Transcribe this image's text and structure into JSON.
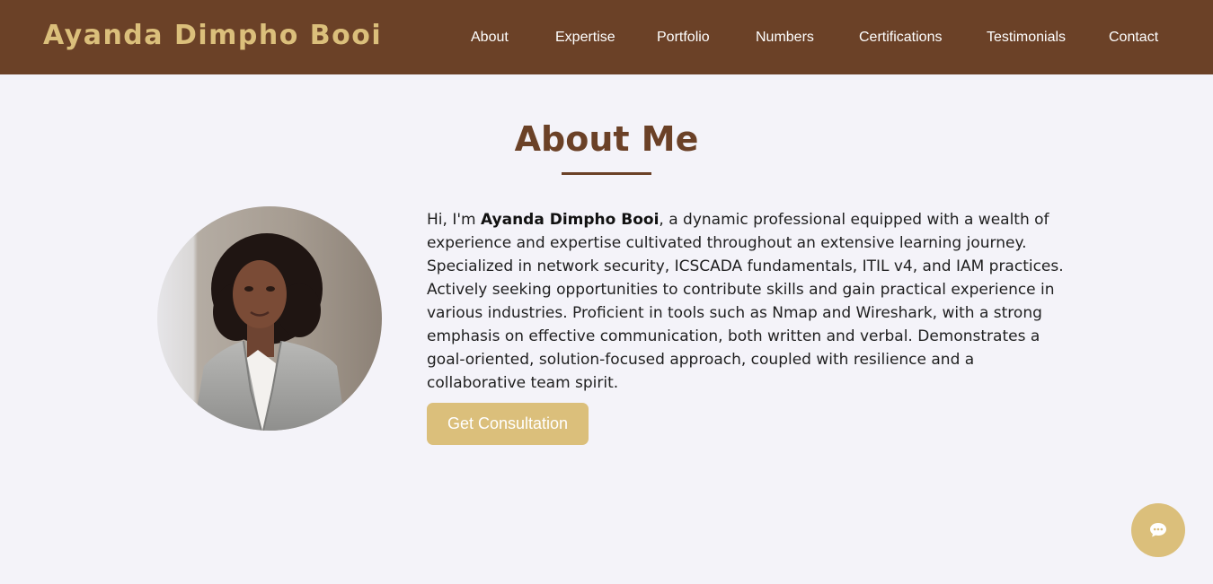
{
  "header": {
    "brand": "Ayanda Dimpho Booi",
    "nav": [
      {
        "label": "About"
      },
      {
        "label": "Expertise"
      },
      {
        "label": "Portfolio"
      },
      {
        "label": "Numbers"
      },
      {
        "label": "Certifications"
      },
      {
        "label": "Testimonials"
      },
      {
        "label": "Contact"
      }
    ]
  },
  "about": {
    "title": "About Me",
    "bio_prefix": "Hi, I'm ",
    "bio_name": "Ayanda Dimpho Booi",
    "bio_rest": ", a dynamic professional equipped with a wealth of experience and expertise cultivated throughout an extensive learning journey. Specialized in network security, ICSCADA fundamentals, ITIL v4, and IAM practices. Actively seeking opportunities to contribute skills and gain practical experience in various industries. Proficient in tools such as Nmap and Wireshark, with a strong emphasis on effective communication, both written and verbal. Demonstrates a goal-oriented, solution-focused approach, coupled with resilience and a collaborative team spirit.",
    "cta_label": "Get Consultation"
  },
  "chat": {
    "icon": "chat-bubble-icon"
  },
  "colors": {
    "primary_brown": "#6b4127",
    "accent_gold": "#dbbf7b",
    "page_background": "#f4f3f9"
  }
}
